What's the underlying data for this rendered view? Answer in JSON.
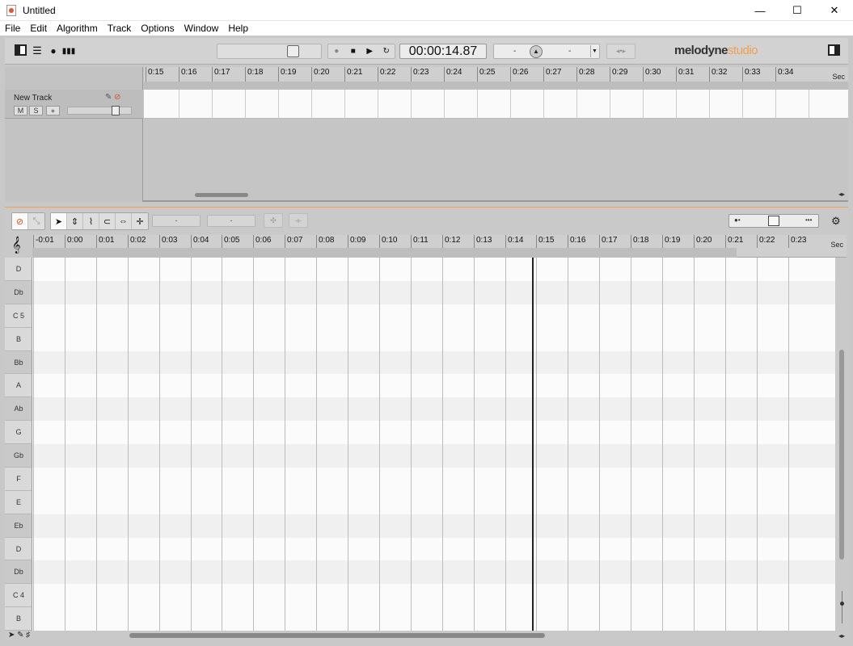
{
  "window": {
    "title": "Untitled",
    "controls": [
      "—",
      "☐",
      "✕"
    ]
  },
  "menu": [
    "File",
    "Edit",
    "Algorithm",
    "Track",
    "Options",
    "Window",
    "Help"
  ],
  "toolbar": {
    "time_display": "00:00:14.87",
    "tempo_left": "-",
    "tempo_right": "-",
    "logo_main": "melodyne",
    "logo_sub": "studio"
  },
  "arrange": {
    "track_name": "New Track",
    "mute_label": "M",
    "solo_label": "S",
    "ruler_unit": "Sec",
    "ruler_ticks": [
      "0:15",
      "0:16",
      "0:17",
      "0:18",
      "0:19",
      "0:20",
      "0:21",
      "0:22",
      "0:23",
      "0:24",
      "0:25",
      "0:26",
      "0:27",
      "0:28",
      "0:29",
      "0:30",
      "0:31",
      "0:32",
      "0:33",
      "0:34"
    ]
  },
  "editor": {
    "field_1": "-",
    "field_2": "-",
    "ruler_unit": "Sec",
    "ruler_ticks": [
      "-0:01",
      "0:00",
      "0:01",
      "0:02",
      "0:03",
      "0:04",
      "0:05",
      "0:06",
      "0:07",
      "0:08",
      "0:09",
      "0:10",
      "0:11",
      "0:12",
      "0:13",
      "0:14",
      "0:15",
      "0:16",
      "0:17",
      "0:18",
      "0:19",
      "0:20",
      "0:21",
      "0:22",
      "0:23"
    ],
    "pitch_keys": [
      {
        "label": "D",
        "black": false
      },
      {
        "label": "Db",
        "black": true
      },
      {
        "label": "C 5",
        "black": false
      },
      {
        "label": "B",
        "black": false
      },
      {
        "label": "Bb",
        "black": true
      },
      {
        "label": "A",
        "black": false
      },
      {
        "label": "Ab",
        "black": true
      },
      {
        "label": "G",
        "black": false
      },
      {
        "label": "Gb",
        "black": true
      },
      {
        "label": "F",
        "black": false
      },
      {
        "label": "E",
        "black": false
      },
      {
        "label": "Eb",
        "black": true
      },
      {
        "label": "D",
        "black": false
      },
      {
        "label": "Db",
        "black": true
      },
      {
        "label": "C 4",
        "black": false
      },
      {
        "label": "B",
        "black": false
      }
    ]
  },
  "colors": {
    "accent": "#f0a050",
    "record_red": "#d05030"
  }
}
